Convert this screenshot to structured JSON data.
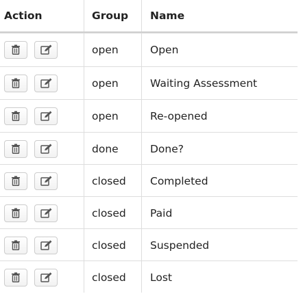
{
  "table": {
    "headers": {
      "action": "Action",
      "group": "Group",
      "name": "Name"
    },
    "rows": [
      {
        "group": "open",
        "name": "Open"
      },
      {
        "group": "open",
        "name": "Waiting Assessment"
      },
      {
        "group": "open",
        "name": "Re-opened"
      },
      {
        "group": "done",
        "name": "Done?"
      },
      {
        "group": "closed",
        "name": "Completed"
      },
      {
        "group": "closed",
        "name": "Paid"
      },
      {
        "group": "closed",
        "name": "Suspended"
      },
      {
        "group": "closed",
        "name": "Lost"
      }
    ],
    "row_actions": {
      "delete_icon": "trash-icon",
      "edit_icon": "edit-icon"
    }
  }
}
